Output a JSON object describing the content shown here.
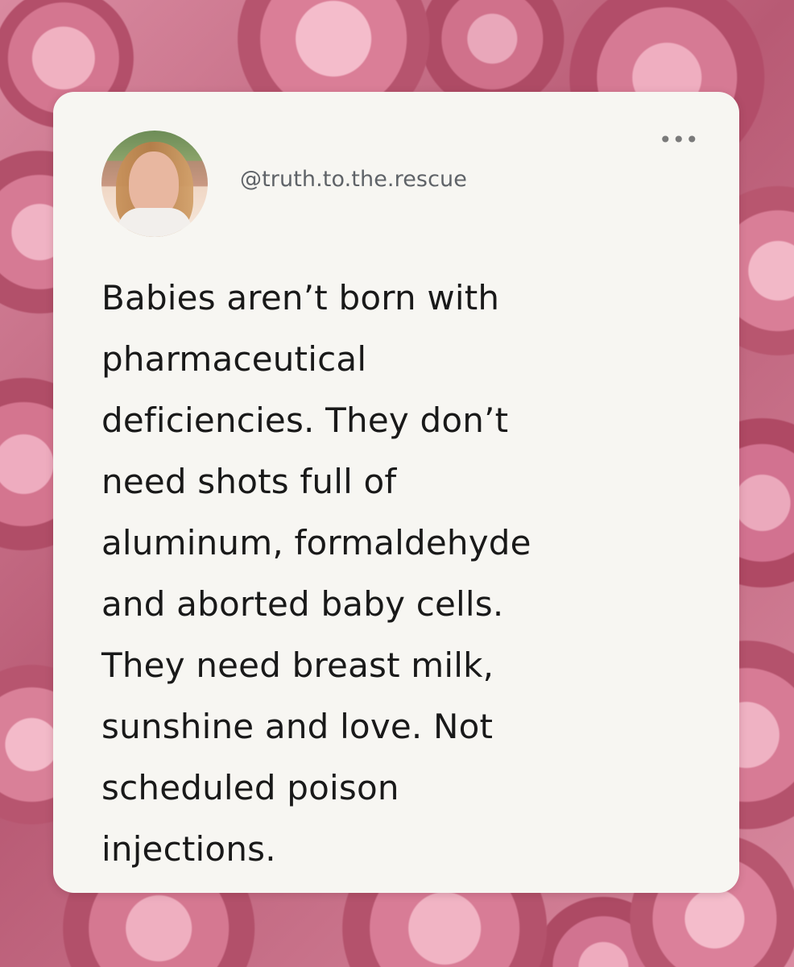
{
  "post": {
    "handle": "@truth.to.the.rescue",
    "text": "Babies aren’t born with\npharmaceutical\ndeficiencies. They don’t\nneed shots full of\naluminum, formaldehyde\nand aborted baby cells.\nThey need breast milk,\nsunshine and love. Not\nscheduled poison\ninjections.",
    "more_icon": "more-horizontal-icon"
  },
  "colors": {
    "card_background": "#f7f6f2",
    "text": "#191919",
    "handle_text": "#5f6368",
    "rose_background": "#c86b82"
  }
}
